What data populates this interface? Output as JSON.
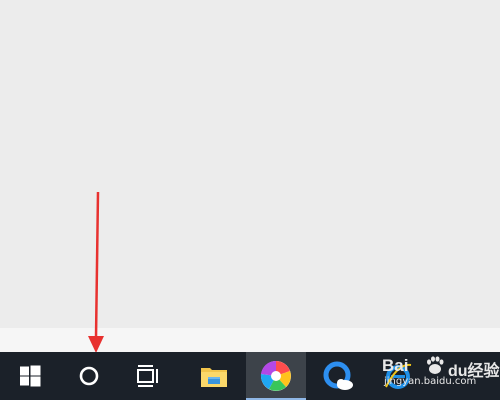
{
  "taskbar": {
    "items": [
      {
        "icon": "windows-start-icon"
      },
      {
        "icon": "cortana-search-icon"
      },
      {
        "icon": "task-view-icon"
      },
      {
        "icon": "file-explorer-icon"
      },
      {
        "icon": "pinwheel-app-icon",
        "active": true
      },
      {
        "icon": "browser-q-icon"
      },
      {
        "icon": "ie-edge-icon"
      }
    ],
    "background": "#1b2129",
    "active_indicator": "#8fb7e6"
  },
  "annotation": {
    "arrow_color": "#e8312f",
    "points_to": "cortana-search-icon"
  },
  "watermark": {
    "brand": "Bai",
    "brand_2": "du",
    "suffix": "经验",
    "url": "jingyan.baidu.com"
  }
}
